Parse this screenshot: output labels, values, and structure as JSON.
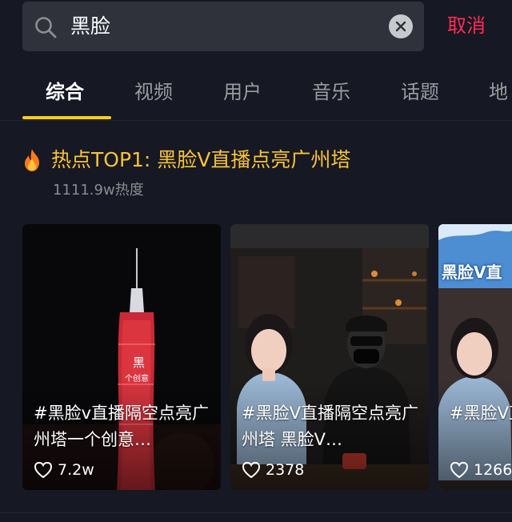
{
  "search": {
    "query": "黑脸",
    "cancel_label": "取消"
  },
  "tabs": [
    {
      "label": "综合",
      "active": true
    },
    {
      "label": "视频",
      "active": false
    },
    {
      "label": "用户",
      "active": false
    },
    {
      "label": "音乐",
      "active": false
    },
    {
      "label": "话题",
      "active": false
    },
    {
      "label": "地",
      "active": false
    }
  ],
  "hot": {
    "title": "热点TOP1: 黑脸V直播点亮广州塔",
    "heat": "1111.9w热度"
  },
  "cards": [
    {
      "caption": "#黑脸v直播隔空点亮广州塔一个创意…",
      "likes": "7.2w"
    },
    {
      "caption": "#黑脸V直播隔空点亮广州塔 黑脸V…",
      "likes": "2378"
    },
    {
      "caption": "#黑脸V直播隔空点亮广州塔",
      "likes": "1266"
    }
  ],
  "card3_banner": "黑脸V直",
  "colors": {
    "background": "#161823",
    "accent_yellow": "#face15",
    "hot_title": "#f7c23b",
    "cancel_red": "#fe2c55",
    "search_bg": "#2f313b"
  },
  "icons": [
    "search-icon",
    "clear-icon",
    "flame-icon",
    "heart-icon"
  ]
}
